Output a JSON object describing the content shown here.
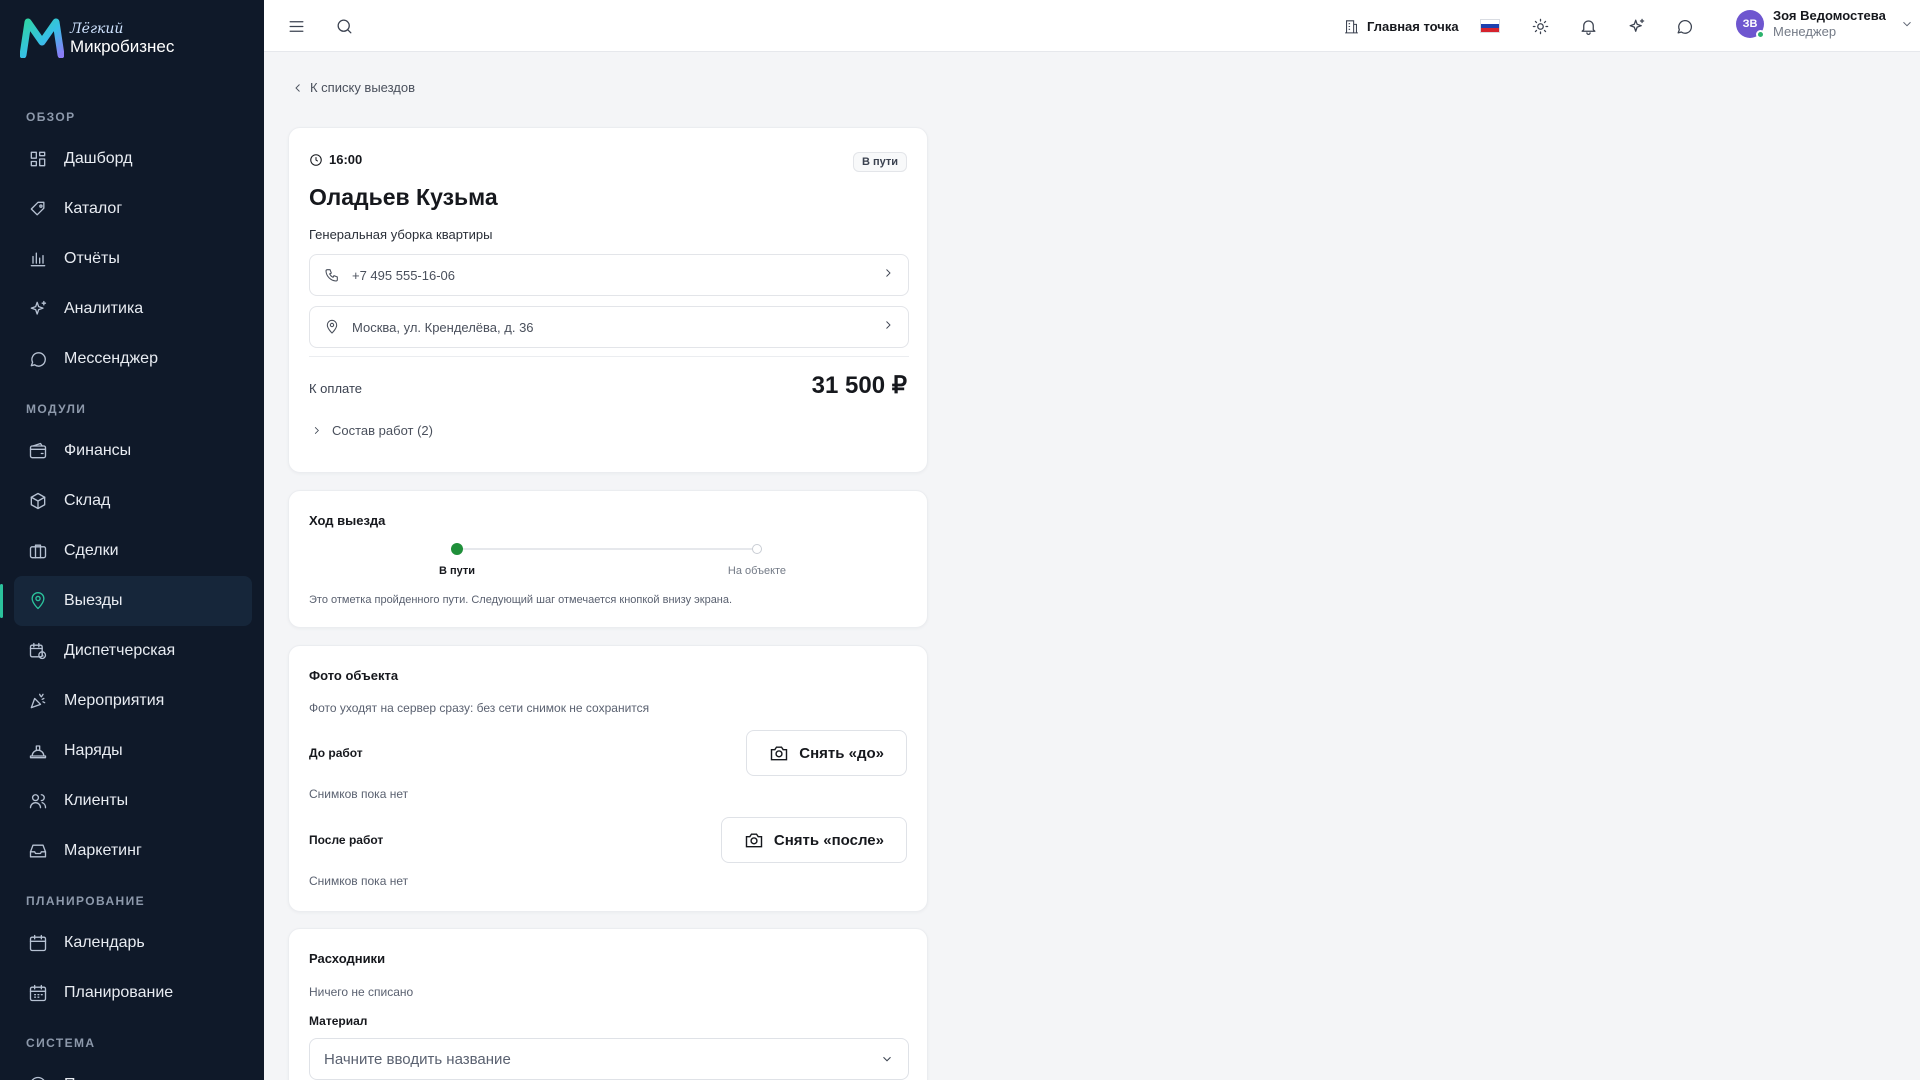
{
  "brand": {
    "small": "Лёгкий",
    "name": "Микробизнес"
  },
  "sidebar": {
    "sections": [
      {
        "title": "ОБЗОР",
        "items": [
          {
            "label": "Дашборд",
            "icon": "dashboard-icon"
          },
          {
            "label": "Каталог",
            "icon": "catalog-icon"
          },
          {
            "label": "Отчёты",
            "icon": "reports-icon"
          },
          {
            "label": "Аналитика",
            "icon": "sparkles-icon"
          },
          {
            "label": "Мессенджер",
            "icon": "chat-icon"
          }
        ]
      },
      {
        "title": "МОДУЛИ",
        "items": [
          {
            "label": "Финансы",
            "icon": "wallet-icon"
          },
          {
            "label": "Склад",
            "icon": "box-icon"
          },
          {
            "label": "Сделки",
            "icon": "briefcase-icon"
          },
          {
            "label": "Выезды",
            "icon": "map-pin-icon",
            "active": true
          },
          {
            "label": "Диспетчерская",
            "icon": "calendar-clock-icon"
          },
          {
            "label": "Мероприятия",
            "icon": "party-icon"
          },
          {
            "label": "Наряды",
            "icon": "hard-hat-icon"
          },
          {
            "label": "Клиенты",
            "icon": "users-icon"
          },
          {
            "label": "Маркетинг",
            "icon": "inbox-icon"
          }
        ]
      },
      {
        "title": "ПЛАНИРОВАНИЕ",
        "items": [
          {
            "label": "Календарь",
            "icon": "calendar-icon"
          },
          {
            "label": "Планирование",
            "icon": "calendar-grid-icon"
          }
        ]
      },
      {
        "title": "СИСТЕМА",
        "items": [
          {
            "label": "Поддержка",
            "icon": "help-icon"
          }
        ]
      }
    ]
  },
  "topbar": {
    "branch": "Главная точка",
    "user": {
      "initials": "ЗВ",
      "name": "Зоя Ведомостева",
      "role": "Менеджер"
    }
  },
  "back_link": "К списку выездов",
  "visit": {
    "time": "16:00",
    "status": "В пути",
    "client": "Оладьев Кузьма",
    "service": "Генеральная уборка квартиры",
    "phone": "+7 495 555-16-06",
    "address": "Москва, ул. Кренделёва, д. 36",
    "pay_label": "К оплате",
    "pay_amount": "31 500 ₽",
    "works_label": "Состав работ (2)"
  },
  "progress": {
    "title": "Ход выезда",
    "steps": [
      {
        "label": "В пути",
        "done": true
      },
      {
        "label": "На объекте",
        "done": false
      }
    ],
    "hint": "Это отметка пройденного пути. Следующий шаг отмечается кнопкой внизу экрана."
  },
  "photos": {
    "title": "Фото объекта",
    "subtitle": "Фото уходят на сервер сразу: без сети снимок не сохранится",
    "before_label": "До работ",
    "before_button": "Снять «до»",
    "before_empty": "Снимков пока нет",
    "after_label": "После работ",
    "after_button": "Снять «после»",
    "after_empty": "Снимков пока нет"
  },
  "consumables": {
    "title": "Расходники",
    "empty": "Ничего не списано",
    "material_label": "Материал",
    "material_placeholder": "Начните вводить название"
  },
  "colors": {
    "sidebar_bg": "#0f1929",
    "accent": "#2bc29c",
    "progress_done": "#1f8f3a",
    "avatar": "#6e56cf"
  }
}
